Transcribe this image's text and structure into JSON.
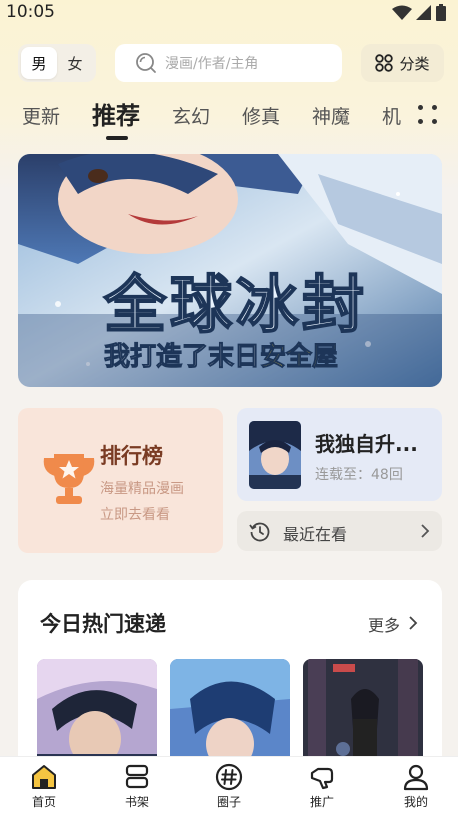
{
  "status": {
    "time": "10:05"
  },
  "header": {
    "gender_options": [
      "男",
      "女"
    ],
    "gender_selected": "男",
    "search_placeholder": "漫画/作者/主角",
    "category_label": "分类"
  },
  "tabs": [
    {
      "label": "更新",
      "active": false
    },
    {
      "label": "推荐",
      "active": true
    },
    {
      "label": "玄幻",
      "active": false
    },
    {
      "label": "修真",
      "active": false
    },
    {
      "label": "神魔",
      "active": false
    },
    {
      "label": "机",
      "active": false
    }
  ],
  "banner": {
    "title": "全球冰封",
    "subtitle_part1": "我打造了末日",
    "subtitle_part2": "安全屋"
  },
  "ranking": {
    "title": "排行榜",
    "line1": "海量精品漫画",
    "line2": "立即去看看"
  },
  "continue_reading": {
    "title": "我独自升...",
    "progress": "连载至：48回"
  },
  "recent": {
    "label": "最近在看"
  },
  "hot": {
    "title": "今日热门速递",
    "more_label": "更多"
  },
  "bottom_nav": [
    {
      "label": "首页",
      "icon": "home-icon",
      "active": true
    },
    {
      "label": "书架",
      "icon": "bookshelf-icon",
      "active": false
    },
    {
      "label": "圈子",
      "icon": "hashtag-icon",
      "active": false
    },
    {
      "label": "推广",
      "icon": "promote-icon",
      "active": false
    },
    {
      "label": "我的",
      "icon": "profile-icon",
      "active": false
    }
  ],
  "colors": {
    "accent": "#f5c542",
    "rank_card_bg": "#f9e5da",
    "rank_title": "#7a3b23",
    "continue_card_bg": "#e5eaf6"
  }
}
